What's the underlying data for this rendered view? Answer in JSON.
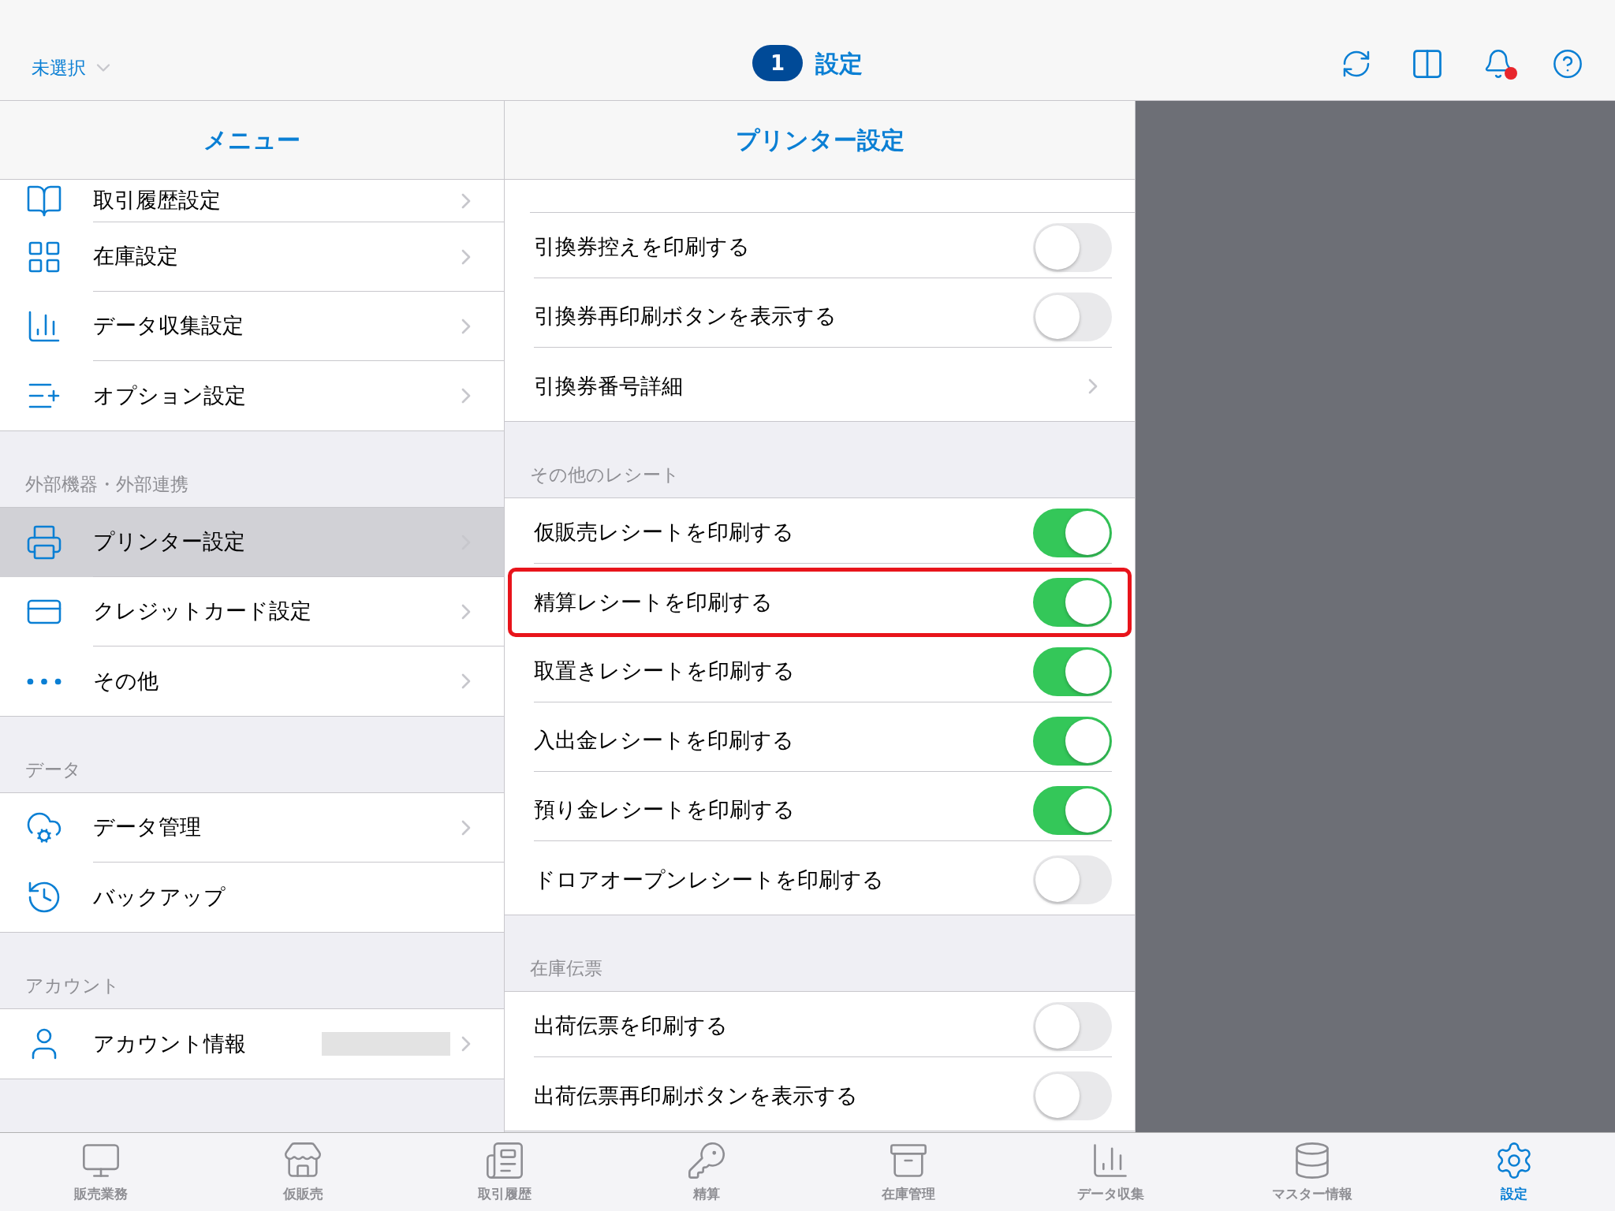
{
  "top_bar": {
    "store_selector": "未選択",
    "badge": "1",
    "title": "設定",
    "notification_dot": true
  },
  "menu": {
    "title": "メニュー",
    "sections": [
      {
        "items": [
          {
            "label": "取引履歴設定",
            "chevron": true,
            "selected": false
          },
          {
            "label": "在庫設定",
            "chevron": true,
            "selected": false
          },
          {
            "label": "データ収集設定",
            "chevron": true,
            "selected": false
          },
          {
            "label": "オプション設定",
            "chevron": true,
            "selected": false
          }
        ]
      },
      {
        "title": "外部機器・外部連携",
        "items": [
          {
            "label": "プリンター設定",
            "chevron": true,
            "selected": true
          },
          {
            "label": "クレジットカード設定",
            "chevron": true,
            "selected": false
          },
          {
            "label": "その他",
            "chevron": true,
            "selected": false
          }
        ]
      },
      {
        "title": "データ",
        "items": [
          {
            "label": "データ管理",
            "chevron": true,
            "selected": false
          },
          {
            "label": "バックアップ",
            "chevron": false,
            "selected": false
          }
        ]
      },
      {
        "title": "アカウント",
        "items": [
          {
            "label": "アカウント情報",
            "chevron": true,
            "selected": false,
            "redacted": true
          }
        ]
      }
    ]
  },
  "detail": {
    "title": "プリンター設定",
    "sections": [
      {
        "items": [
          {
            "kind": "toggle",
            "label": "引換券控えを印刷する",
            "on": false
          },
          {
            "kind": "toggle",
            "label": "引換券再印刷ボタンを表示する",
            "on": false
          },
          {
            "kind": "link",
            "label": "引換券番号詳細"
          }
        ]
      },
      {
        "title": "その他のレシート",
        "items": [
          {
            "kind": "toggle",
            "label": "仮販売レシートを印刷する",
            "on": true
          },
          {
            "kind": "toggle",
            "label": "精算レシートを印刷する",
            "on": true,
            "highlighted": true
          },
          {
            "kind": "toggle",
            "label": "取置きレシートを印刷する",
            "on": true
          },
          {
            "kind": "toggle",
            "label": "入出金レシートを印刷する",
            "on": true
          },
          {
            "kind": "toggle",
            "label": "預り金レシートを印刷する",
            "on": true
          },
          {
            "kind": "toggle",
            "label": "ドロアオープンレシートを印刷する",
            "on": false
          }
        ]
      },
      {
        "title": "在庫伝票",
        "items": [
          {
            "kind": "toggle",
            "label": "出荷伝票を印刷する",
            "on": false
          },
          {
            "kind": "toggle",
            "label": "出荷伝票再印刷ボタンを表示する",
            "on": false
          }
        ]
      }
    ]
  },
  "tab_bar": [
    {
      "label": "販売業務",
      "selected": false
    },
    {
      "label": "仮販売",
      "selected": false
    },
    {
      "label": "取引履歴",
      "selected": false
    },
    {
      "label": "精算",
      "selected": false
    },
    {
      "label": "在庫管理",
      "selected": false
    },
    {
      "label": "データ収集",
      "selected": false
    },
    {
      "label": "マスター情報",
      "selected": false
    },
    {
      "label": "設定",
      "selected": true
    }
  ]
}
